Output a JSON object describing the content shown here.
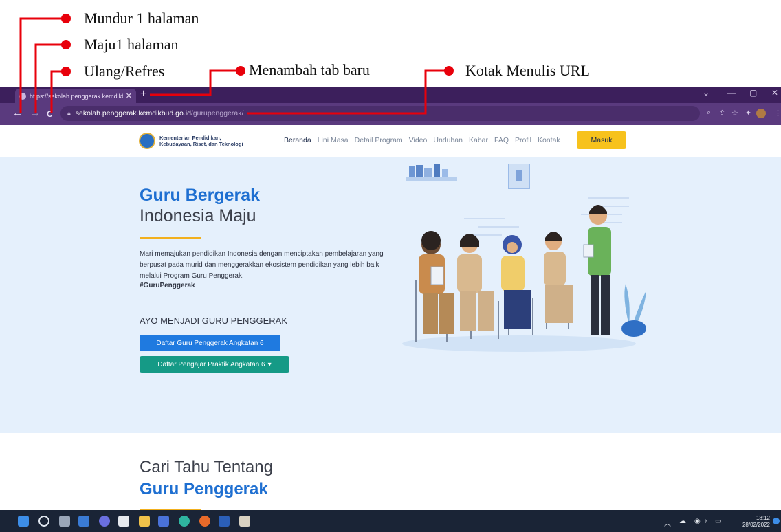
{
  "annotations": {
    "back": "Mundur 1 halaman",
    "forward": "Maju1 halaman",
    "reload": "Ulang/Refres",
    "new_tab": "Menambah tab baru",
    "url_box": "Kotak Menulis URL",
    "marker_color": "#e8000b"
  },
  "browser": {
    "tab_title": "https://sekolah.penggerak.kemdikbud",
    "tab_close": "✕",
    "new_tab_glyph": "+",
    "url_host": "sekolah.penggerak.kemdikbud.go.id",
    "url_path": "/gurupenggerak/",
    "back_glyph": "←",
    "forward_glyph": "→",
    "reload_glyph": "C",
    "theme_color": "#3c1f5c"
  },
  "site": {
    "logo_line1": "Kementerian Pendidikan,",
    "logo_line2": "Kebudayaan, Riset, dan Teknologi",
    "nav": [
      "Beranda",
      "Lini Masa",
      "Detail Program",
      "Video",
      "Unduhan",
      "Kabar",
      "FAQ",
      "Profil",
      "Kontak"
    ],
    "login_label": "Masuk"
  },
  "hero": {
    "title_1": "Guru Bergerak",
    "title_2": "Indonesia Maju",
    "description": "Mari memajukan pendidikan Indonesia dengan menciptakan pembelajaran yang berpusat pada murid dan menggerakkan ekosistem pendidikan yang lebih baik melalui Program Guru Penggerak.",
    "hashtag": "#GuruPenggerak",
    "cta_heading": "AYO MENJADI GURU PENGGERAK",
    "btn_guru": "Daftar Guru Penggerak Angkatan 6",
    "btn_pengajar": "Daftar Pengajar Praktik Angkatan 6",
    "accent_color": "#1e6fd1"
  },
  "section2": {
    "title_1": "Cari Tahu Tentang",
    "title_2": "Guru Penggerak"
  },
  "taskbar": {
    "time": "18:12",
    "date": "28/02/2022"
  }
}
